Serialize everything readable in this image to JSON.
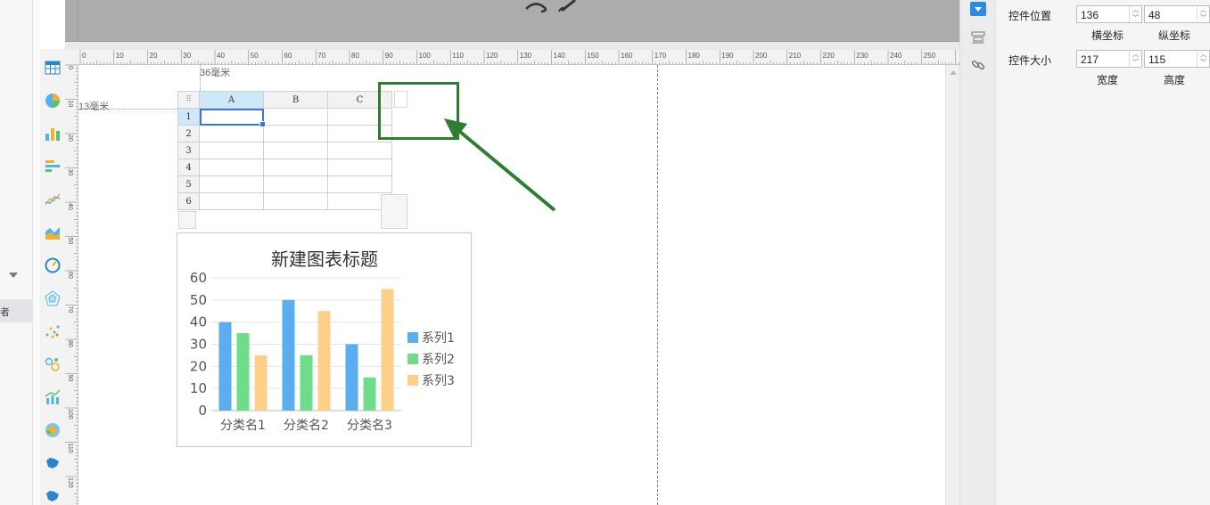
{
  "left_panel": {
    "selected_item_char": "者"
  },
  "ruler_h_ticks": [
    "0",
    "10",
    "20",
    "30",
    "40",
    "50",
    "60",
    "70",
    "80",
    "90",
    "100",
    "110",
    "120",
    "130",
    "140",
    "150",
    "160",
    "170",
    "180",
    "190",
    "200",
    "210",
    "220",
    "230",
    "240",
    "250",
    "2"
  ],
  "ruler_v_ticks": [
    "0",
    "10",
    "20",
    "30",
    "40",
    "50",
    "60",
    "70",
    "80",
    "90",
    "100",
    "110",
    "120"
  ],
  "canvas": {
    "top_offset_label": "36毫米",
    "left_offset_label": "13毫米"
  },
  "sheet": {
    "columns": [
      "A",
      "B",
      "C"
    ],
    "rows": [
      "1",
      "2",
      "3",
      "4",
      "5",
      "6"
    ]
  },
  "chart_data": {
    "type": "bar",
    "title": "新建图表标题",
    "categories": [
      "分类名1",
      "分类名2",
      "分类名3"
    ],
    "series": [
      {
        "name": "系列1",
        "values": [
          40,
          50,
          30
        ],
        "color": "#5aaef0"
      },
      {
        "name": "系列2",
        "values": [
          35,
          25,
          15
        ],
        "color": "#6fdc8c"
      },
      {
        "name": "系列3",
        "values": [
          25,
          45,
          55
        ],
        "color": "#fcd088"
      }
    ],
    "yticks": [
      "0",
      "10",
      "20",
      "30",
      "40",
      "50",
      "60"
    ],
    "ylim": [
      0,
      60
    ],
    "grid": true,
    "legend_position": "right"
  },
  "props": {
    "position_label": "控件位置",
    "x_value": "136",
    "y_value": "48",
    "x_caption": "横坐标",
    "y_caption": "纵坐标",
    "size_label": "控件大小",
    "width_value": "217",
    "height_value": "115",
    "width_caption": "宽度",
    "height_caption": "高度"
  },
  "colors": {
    "highlight": "#2e7d32",
    "accent": "#2d8ae0"
  }
}
